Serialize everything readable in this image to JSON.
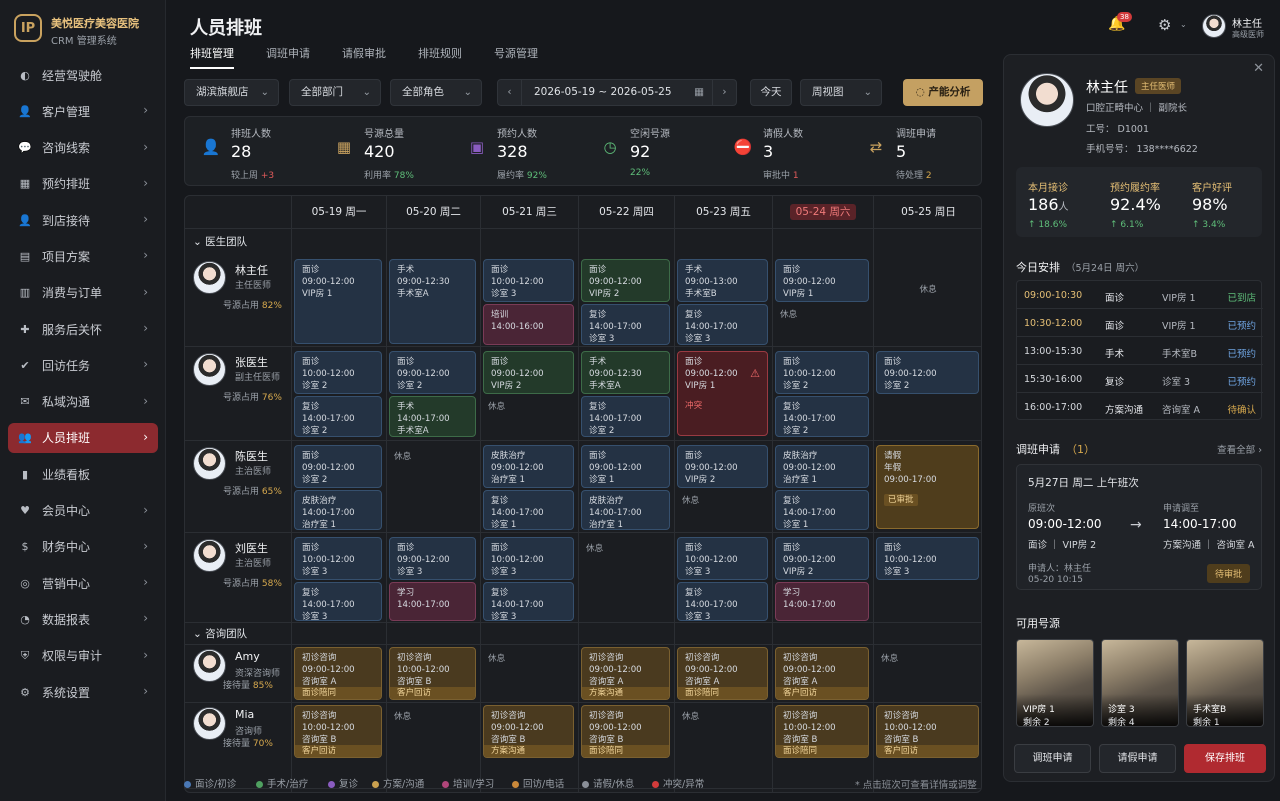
{
  "brand": {
    "name": "美悦医疗美容医院",
    "sub": "CRM 管理系统",
    "logo": "IP"
  },
  "nav": [
    {
      "label": "经营驾驶舱",
      "icon": "dashboard-icon",
      "chev": false
    },
    {
      "label": "客户管理",
      "icon": "user-icon",
      "chev": true
    },
    {
      "label": "咨询线索",
      "icon": "chat-icon",
      "chev": true
    },
    {
      "label": "预约排班",
      "icon": "calendar-icon",
      "chev": true
    },
    {
      "label": "到店接待",
      "icon": "person-icon",
      "chev": true
    },
    {
      "label": "项目方案",
      "icon": "doc-icon",
      "chev": true
    },
    {
      "label": "消费与订单",
      "icon": "receipt-icon",
      "chev": true
    },
    {
      "label": "服务后关怀",
      "icon": "care-icon",
      "chev": true
    },
    {
      "label": "回访任务",
      "icon": "check-icon",
      "chev": true
    },
    {
      "label": "私域沟通",
      "icon": "message-icon",
      "chev": true
    },
    {
      "label": "人员排班",
      "icon": "team-icon",
      "chev": true,
      "active": true
    },
    {
      "label": "业绩看板",
      "icon": "chart-icon",
      "chev": false
    },
    {
      "label": "会员中心",
      "icon": "heart-icon",
      "chev": true
    },
    {
      "label": "财务中心",
      "icon": "money-icon",
      "chev": true
    },
    {
      "label": "营销中心",
      "icon": "megaphone-icon",
      "chev": true
    },
    {
      "label": "数据报表",
      "icon": "report-icon",
      "chev": true
    },
    {
      "label": "权限与审计",
      "icon": "shield-icon",
      "chev": true
    },
    {
      "label": "系统设置",
      "icon": "gear-icon",
      "chev": true
    }
  ],
  "header": {
    "title": "人员排班",
    "tabs": [
      "排班管理",
      "调班申请",
      "请假审批",
      "排班规则",
      "号源管理"
    ],
    "active_tab": 0
  },
  "filters": {
    "store": "湖滨旗舰店",
    "dept": "全部部门",
    "role": "全部角色",
    "date_range": "2026-05-19 ~ 2026-05-25",
    "today": "今天",
    "view": "周视图",
    "ai": "产能分析"
  },
  "stats": [
    {
      "label": "排班人数",
      "value": "28",
      "sub": "较上周",
      "delta": "+3",
      "icon": "person-icon",
      "tone": "red"
    },
    {
      "label": "号源总量",
      "value": "420",
      "sub": "利用率",
      "delta": "78%",
      "icon": "calendar-icon",
      "tone": "hl"
    },
    {
      "label": "预约人数",
      "value": "328",
      "sub": "履约率",
      "delta": "92%",
      "icon": "appt-icon",
      "tone": "hl"
    },
    {
      "label": "空闲号源",
      "value": "92",
      "sub": "",
      "delta": "22%",
      "icon": "clock-icon",
      "tone": "hl"
    },
    {
      "label": "请假人数",
      "value": "3",
      "sub": "审批中",
      "delta": "1",
      "icon": "leave-icon",
      "tone": "red"
    },
    {
      "label": "调班申请",
      "value": "5",
      "sub": "待处理",
      "delta": "2",
      "icon": "swap-icon",
      "tone": "gold"
    }
  ],
  "days": [
    "05-19 周一",
    "05-20 周二",
    "05-21 周三",
    "05-22 周四",
    "05-23 周五",
    "05-24 周六",
    "05-25 周日"
  ],
  "today_index": 5,
  "groups": [
    {
      "label": "医生团队"
    },
    {
      "label": "咨询团队"
    }
  ],
  "people": [
    {
      "name": "林主任",
      "role": "主任医师",
      "occ_label": "号源占用",
      "occ": "82%"
    },
    {
      "name": "张医生",
      "role": "副主任医师",
      "occ_label": "号源占用",
      "occ": "76%"
    },
    {
      "name": "陈医生",
      "role": "主治医师",
      "occ_label": "号源占用",
      "occ": "65%"
    },
    {
      "name": "刘医生",
      "role": "主治医师",
      "occ_label": "号源占用",
      "occ": "58%"
    },
    {
      "name": "Amy",
      "role": "资深咨询师",
      "occ_label": "接待量",
      "occ": "85%"
    },
    {
      "name": "Mia",
      "role": "咨询师",
      "occ_label": "接待量",
      "occ": "70%"
    }
  ],
  "rest_label": "休息",
  "shifts": [
    [
      [
        {
          "t": "面诊",
          "h": "09:00-12:00",
          "r": "VIP房 1",
          "c": "blue",
          "s": "full"
        }
      ],
      [
        {
          "t": "手术",
          "h": "09:00-12:30",
          "r": "手术室A",
          "c": "blue",
          "s": "full"
        }
      ],
      [
        {
          "t": "面诊",
          "h": "10:00-12:00",
          "r": "诊室 3",
          "c": "blue",
          "s": "top"
        },
        {
          "t": "培训",
          "h": "14:00-16:00",
          "r": "",
          "c": "purple",
          "s": "bot"
        }
      ],
      [
        {
          "t": "面诊",
          "h": "09:00-12:00",
          "r": "VIP房 2",
          "c": "green",
          "s": "top"
        },
        {
          "t": "复诊",
          "h": "14:00-17:00",
          "r": "诊室 3",
          "c": "blue",
          "s": "bot"
        }
      ],
      [
        {
          "t": "手术",
          "h": "09:00-13:00",
          "r": "手术室B",
          "c": "blue",
          "s": "top"
        },
        {
          "t": "复诊",
          "h": "14:00-17:00",
          "r": "诊室 3",
          "c": "blue",
          "s": "bot"
        }
      ],
      [
        {
          "t": "面诊",
          "h": "09:00-12:00",
          "r": "VIP房 1",
          "c": "blue",
          "s": "top"
        },
        {
          "rest": true,
          "s": "botrest"
        }
      ],
      [
        {
          "rest": true,
          "s": "center",
          "cell": true
        }
      ]
    ],
    [
      [
        {
          "t": "面诊",
          "h": "10:00-12:00",
          "r": "诊室 2",
          "c": "blue",
          "s": "top"
        },
        {
          "t": "复诊",
          "h": "14:00-17:00",
          "r": "诊室 2",
          "c": "blue",
          "s": "bot"
        }
      ],
      [
        {
          "t": "面诊",
          "h": "09:00-12:00",
          "r": "诊室 2",
          "c": "blue",
          "s": "top"
        },
        {
          "t": "手术",
          "h": "14:00-17:00",
          "r": "手术室A",
          "c": "green",
          "s": "bot"
        }
      ],
      [
        {
          "t": "面诊",
          "h": "09:00-12:00",
          "r": "VIP房 2",
          "c": "green",
          "s": "top"
        },
        {
          "rest": true,
          "s": "botrest"
        }
      ],
      [
        {
          "t": "手术",
          "h": "09:00-12:30",
          "r": "手术室A",
          "c": "green",
          "s": "top"
        },
        {
          "t": "复诊",
          "h": "14:00-17:00",
          "r": "诊室 2",
          "c": "blue",
          "s": "bot"
        }
      ],
      [
        {
          "t": "面诊",
          "h": "09:00-12:00",
          "r": "VIP房 1",
          "c": "conflict",
          "s": "full",
          "conflict": "冲突"
        }
      ],
      [
        {
          "t": "面诊",
          "h": "10:00-12:00",
          "r": "诊室 2",
          "c": "blue",
          "s": "top"
        },
        {
          "t": "复诊",
          "h": "14:00-17:00",
          "r": "诊室 2",
          "c": "blue",
          "s": "bot"
        }
      ],
      [
        {
          "t": "面诊",
          "h": "09:00-12:00",
          "r": "诊室 2",
          "c": "blue",
          "s": "top"
        }
      ]
    ],
    [
      [
        {
          "t": "面诊",
          "h": "09:00-12:00",
          "r": "诊室 2",
          "c": "blue",
          "s": "top"
        },
        {
          "t": "皮肤治疗",
          "h": "14:00-17:00",
          "r": "治疗室 1",
          "c": "blue",
          "s": "bot"
        }
      ],
      [
        {
          "rest": true,
          "s": "toprest"
        }
      ],
      [
        {
          "t": "皮肤治疗",
          "h": "09:00-12:00",
          "r": "治疗室 1",
          "c": "blue",
          "s": "top"
        },
        {
          "t": "复诊",
          "h": "14:00-17:00",
          "r": "诊室 1",
          "c": "blue",
          "s": "bot"
        }
      ],
      [
        {
          "t": "面诊",
          "h": "09:00-12:00",
          "r": "诊室 1",
          "c": "blue",
          "s": "top"
        },
        {
          "t": "皮肤治疗",
          "h": "14:00-17:00",
          "r": "治疗室 1",
          "c": "blue",
          "s": "bot"
        }
      ],
      [
        {
          "t": "面诊",
          "h": "09:00-12:00",
          "r": "VIP房 2",
          "c": "blue",
          "s": "top"
        },
        {
          "rest": true,
          "s": "botrest"
        }
      ],
      [
        {
          "t": "皮肤治疗",
          "h": "09:00-12:00",
          "r": "治疗室 1",
          "c": "blue",
          "s": "top"
        },
        {
          "t": "复诊",
          "h": "14:00-17:00",
          "r": "诊室 1",
          "c": "blue",
          "s": "bot"
        }
      ],
      [
        {
          "t": "请假",
          "h": "年假",
          "r": "09:00-17:00",
          "c": "gold",
          "s": "full",
          "tag": "已审批"
        }
      ]
    ],
    [
      [
        {
          "t": "面诊",
          "h": "10:00-12:00",
          "r": "诊室 3",
          "c": "blue",
          "s": "top"
        },
        {
          "t": "复诊",
          "h": "14:00-17:00",
          "r": "诊室 3",
          "c": "blue",
          "s": "bot"
        }
      ],
      [
        {
          "t": "面诊",
          "h": "09:00-12:00",
          "r": "诊室 3",
          "c": "blue",
          "s": "top"
        },
        {
          "t": "学习",
          "h": "14:00-17:00",
          "r": "",
          "c": "purple",
          "s": "bot"
        }
      ],
      [
        {
          "t": "面诊",
          "h": "10:00-12:00",
          "r": "诊室 3",
          "c": "blue",
          "s": "top"
        },
        {
          "t": "复诊",
          "h": "14:00-17:00",
          "r": "诊室 3",
          "c": "blue",
          "s": "bot"
        }
      ],
      [
        {
          "rest": true,
          "s": "toprest"
        }
      ],
      [
        {
          "t": "面诊",
          "h": "10:00-12:00",
          "r": "诊室 3",
          "c": "blue",
          "s": "top"
        },
        {
          "t": "复诊",
          "h": "14:00-17:00",
          "r": "诊室 3",
          "c": "blue",
          "s": "bot"
        }
      ],
      [
        {
          "t": "面诊",
          "h": "09:00-12:00",
          "r": "VIP房 2",
          "c": "blue",
          "s": "top"
        },
        {
          "t": "学习",
          "h": "14:00-17:00",
          "r": "",
          "c": "purple",
          "s": "bot"
        }
      ],
      [
        {
          "t": "面诊",
          "h": "10:00-12:00",
          "r": "诊室 3",
          "c": "blue",
          "s": "top"
        }
      ]
    ],
    [
      [
        {
          "t": "初诊咨询",
          "h": "09:00-12:00",
          "r": "咨询室 A",
          "c": "orange",
          "s": "full",
          "tag": "面诊陪同"
        }
      ],
      [
        {
          "t": "初诊咨询",
          "h": "10:00-12:00",
          "r": "咨询室 B",
          "c": "orange",
          "s": "full",
          "tag": "客户回访"
        }
      ],
      [
        {
          "rest": true,
          "s": "toprest"
        }
      ],
      [
        {
          "t": "初诊咨询",
          "h": "09:00-12:00",
          "r": "咨询室 A",
          "c": "orange",
          "s": "full",
          "tag": "方案沟通"
        }
      ],
      [
        {
          "t": "初诊咨询",
          "h": "09:00-12:00",
          "r": "咨询室 A",
          "c": "orange",
          "s": "full",
          "tag": "面诊陪同"
        }
      ],
      [
        {
          "t": "初诊咨询",
          "h": "09:00-12:00",
          "r": "咨询室 A",
          "c": "orange",
          "s": "full",
          "tag": "客户回访"
        }
      ],
      [
        {
          "rest": true,
          "s": "toprest"
        }
      ]
    ],
    [
      [
        {
          "t": "初诊咨询",
          "h": "10:00-12:00",
          "r": "咨询室 B",
          "c": "orange",
          "s": "full",
          "tag": "客户回访"
        }
      ],
      [
        {
          "rest": true,
          "s": "toprest"
        }
      ],
      [
        {
          "t": "初诊咨询",
          "h": "09:00-12:00",
          "r": "咨询室 B",
          "c": "orange",
          "s": "full",
          "tag": "方案沟通"
        }
      ],
      [
        {
          "t": "初诊咨询",
          "h": "09:00-12:00",
          "r": "咨询室 B",
          "c": "orange",
          "s": "full",
          "tag": "面诊陪同"
        }
      ],
      [
        {
          "rest": true,
          "s": "toprest"
        }
      ],
      [
        {
          "t": "初诊咨询",
          "h": "10:00-12:00",
          "r": "咨询室 B",
          "c": "orange",
          "s": "full",
          "tag": "面诊陪同"
        }
      ],
      [
        {
          "t": "初诊咨询",
          "h": "10:00-12:00",
          "r": "咨询室 B",
          "c": "orange",
          "s": "full",
          "tag": "客户回访"
        }
      ]
    ]
  ],
  "legend": [
    {
      "label": "面诊/初诊",
      "color": "#4a78b5"
    },
    {
      "label": "手术/治疗",
      "color": "#4fa060"
    },
    {
      "label": "复诊",
      "color": "#8a5cc0"
    },
    {
      "label": "方案/沟通",
      "color": "#c9a04f"
    },
    {
      "label": "培训/学习",
      "color": "#b0467a"
    },
    {
      "label": "回访/电话",
      "color": "#c9883a"
    },
    {
      "label": "请假/休息",
      "color": "#8a8f98"
    },
    {
      "label": "冲突/异常",
      "color": "#d23b3b"
    }
  ],
  "hint": "* 点击班次可查看详情或调整",
  "topbar": {
    "badge": "38",
    "user": "林主任",
    "user_role": "高级医师"
  },
  "panel": {
    "name": "林主任",
    "title": "主任医师",
    "dept": "口腔正畸中心 ｜ 副院长",
    "id": "工号： D1001",
    "phone": "手机号号： 138****6622",
    "kpis": [
      {
        "label": "本月接诊",
        "value": "186",
        "unit": "人",
        "trend": "↑ 18.6%"
      },
      {
        "label": "预约履约率",
        "value": "92.4%",
        "unit": "",
        "trend": "↑ 6.1%"
      },
      {
        "label": "客户好评",
        "value": "98%",
        "unit": "",
        "trend": "↑ 3.4%"
      }
    ],
    "agenda_title": "今日安排",
    "agenda_date": "（5月24日 周六）",
    "agenda": [
      {
        "time": "09:00-10:30",
        "kind": "面诊",
        "room": "VIP房 1",
        "status": "已到店",
        "tone": "green",
        "gold": true
      },
      {
        "time": "10:30-12:00",
        "kind": "面诊",
        "room": "VIP房 1",
        "status": "已预约",
        "tone": "blue",
        "gold": true
      },
      {
        "time": "13:00-15:30",
        "kind": "手术",
        "room": "手术室B",
        "status": "已预约",
        "tone": "blue",
        "gold": false
      },
      {
        "time": "15:30-16:00",
        "kind": "复诊",
        "room": "诊室 3",
        "status": "已预约",
        "tone": "blue",
        "gold": false
      },
      {
        "time": "16:00-17:00",
        "kind": "方案沟通",
        "room": "咨询室 A",
        "status": "待确认",
        "tone": "gold",
        "gold": false
      }
    ],
    "req_title": "调班申请",
    "req_count": "（1）",
    "see_all": "查看全部 ›",
    "req": {
      "date": "5月27日 周二 上午班次",
      "orig_label": "原班次",
      "orig_time": "09:00-12:00",
      "orig_place": "面诊 ｜ VIP房 2",
      "new_label": "申请调至",
      "new_time": "14:00-17:00",
      "new_place": "方案沟通 ｜ 咨询室 A",
      "applicant": "申请人：林主任",
      "submitted": "05-20 10:15",
      "status": "待审批"
    },
    "rooms_title": "可用号源",
    "rooms": [
      {
        "name": "VIP房 1",
        "left": "剩余 2"
      },
      {
        "name": "诊室 3",
        "left": "剩余 4"
      },
      {
        "name": "手术室B",
        "left": "剩余 1"
      }
    ],
    "buttons": [
      "调班申请",
      "请假申请",
      "保存排班"
    ]
  }
}
